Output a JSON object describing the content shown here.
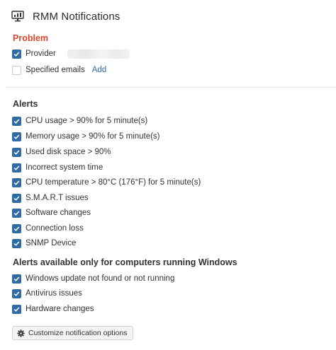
{
  "header": {
    "title": "RMM Notifications",
    "icon": "monitor-chart-icon"
  },
  "problem": {
    "title": "Problem",
    "items": [
      {
        "label": "Provider",
        "checked": true
      },
      {
        "label": "Specified emails",
        "checked": false,
        "link": "Add"
      }
    ]
  },
  "alerts": {
    "title": "Alerts",
    "items": [
      {
        "label": "CPU usage > 90% for 5 minute(s)",
        "checked": true
      },
      {
        "label": "Memory usage > 90% for 5 minute(s)",
        "checked": true
      },
      {
        "label": "Used disk space > 90%",
        "checked": true
      },
      {
        "label": "Incorrect system time",
        "checked": true
      },
      {
        "label": "CPU temperature > 80°C (176°F) for 5 minute(s)",
        "checked": true
      },
      {
        "label": "S.M.A.R.T issues",
        "checked": true
      },
      {
        "label": "Software changes",
        "checked": true
      },
      {
        "label": "Connection loss",
        "checked": true
      },
      {
        "label": "SNMP Device",
        "checked": true
      }
    ]
  },
  "windows_alerts": {
    "title": "Alerts available only for computers running Windows",
    "items": [
      {
        "label": "Windows update not found or not running",
        "checked": true
      },
      {
        "label": "Antivirus issues",
        "checked": true
      },
      {
        "label": "Hardware changes",
        "checked": true
      }
    ]
  },
  "customize_button": {
    "label": "Customize notification options",
    "icon": "gear-icon"
  },
  "colors": {
    "accent": "#2f6ca3",
    "problem": "#d9452b"
  }
}
